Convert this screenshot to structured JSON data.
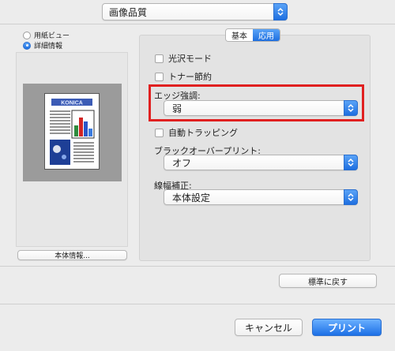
{
  "top_popup": {
    "value": "画像品質"
  },
  "preview_mode": {
    "options": [
      "用紙ビュー",
      "詳細情報"
    ],
    "selected": "詳細情報"
  },
  "device_info_button": "本体情報...",
  "tabs": [
    {
      "label": "基本",
      "active": false
    },
    {
      "label": "応用",
      "active": true
    }
  ],
  "settings": {
    "gloss_mode": {
      "label": "光沢モード",
      "checked": false
    },
    "toner_save": {
      "label": "トナー節約",
      "checked": false
    },
    "edge_enhance": {
      "label": "エッジ強調:",
      "value": "弱"
    },
    "auto_trapping": {
      "label": "自動トラッピング",
      "checked": false
    },
    "black_overprint": {
      "label": "ブラックオーバープリント:",
      "value": "オフ"
    },
    "line_width": {
      "label": "線幅補正:",
      "value": "本体設定"
    }
  },
  "reset_button": "標準に戻す",
  "cancel_button": "キャンセル",
  "print_button": "プリント",
  "colors": {
    "accent": "#1e6fe0",
    "highlight": "#e02020"
  },
  "preview_logo_text": "KONICA"
}
